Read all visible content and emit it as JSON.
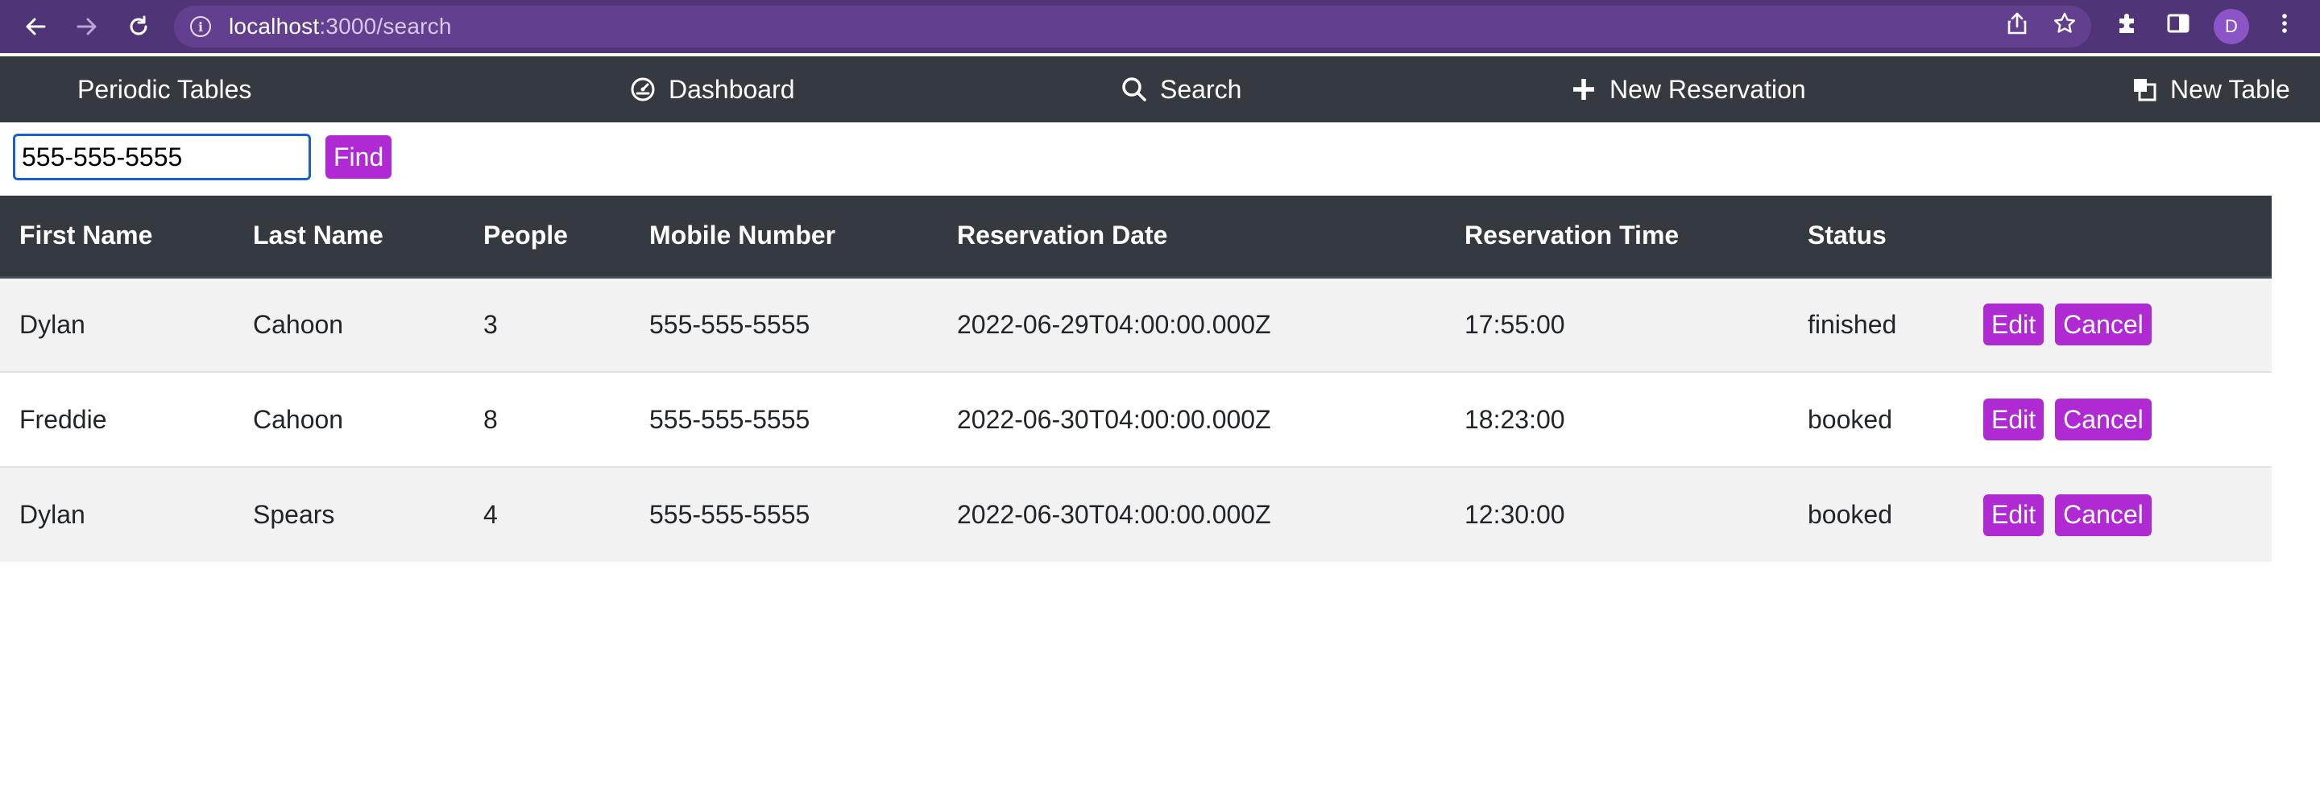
{
  "browser": {
    "url_host": "localhost",
    "url_path": ":3000/search",
    "avatar_letter": "D",
    "icons": [
      "back-arrow-icon",
      "forward-arrow-icon",
      "reload-icon",
      "info-icon",
      "share-icon",
      "star-icon",
      "puzzle-extension-icon",
      "side-panel-icon",
      "kebab-menu-icon"
    ],
    "theme_color": "#4f3477"
  },
  "navbar": {
    "brand": "Periodic Tables",
    "items": [
      {
        "label": "Dashboard",
        "icon": "dashboard-gauge-icon"
      },
      {
        "label": "Search",
        "icon": "search-icon"
      },
      {
        "label": "New Reservation",
        "icon": "plus-icon"
      },
      {
        "label": "New Table",
        "icon": "layers-icon"
      }
    ],
    "background": "#343a40"
  },
  "search": {
    "value": "555-555-5555",
    "find_label": "Find"
  },
  "table": {
    "headers": [
      "First Name",
      "Last Name",
      "People",
      "Mobile Number",
      "Reservation Date",
      "Reservation Time",
      "Status"
    ],
    "rows": [
      {
        "first_name": "Dylan",
        "last_name": "Cahoon",
        "people": "3",
        "mobile": "555-555-5555",
        "date": "2022-06-29T04:00:00.000Z",
        "time": "17:55:00",
        "status": "finished"
      },
      {
        "first_name": "Freddie",
        "last_name": "Cahoon",
        "people": "8",
        "mobile": "555-555-5555",
        "date": "2022-06-30T04:00:00.000Z",
        "time": "18:23:00",
        "status": "booked"
      },
      {
        "first_name": "Dylan",
        "last_name": "Spears",
        "people": "4",
        "mobile": "555-555-5555",
        "date": "2022-06-30T04:00:00.000Z",
        "time": "12:30:00",
        "status": "booked"
      }
    ],
    "edit_label": "Edit",
    "cancel_label": "Cancel"
  },
  "accent_color": "#b02ad4"
}
